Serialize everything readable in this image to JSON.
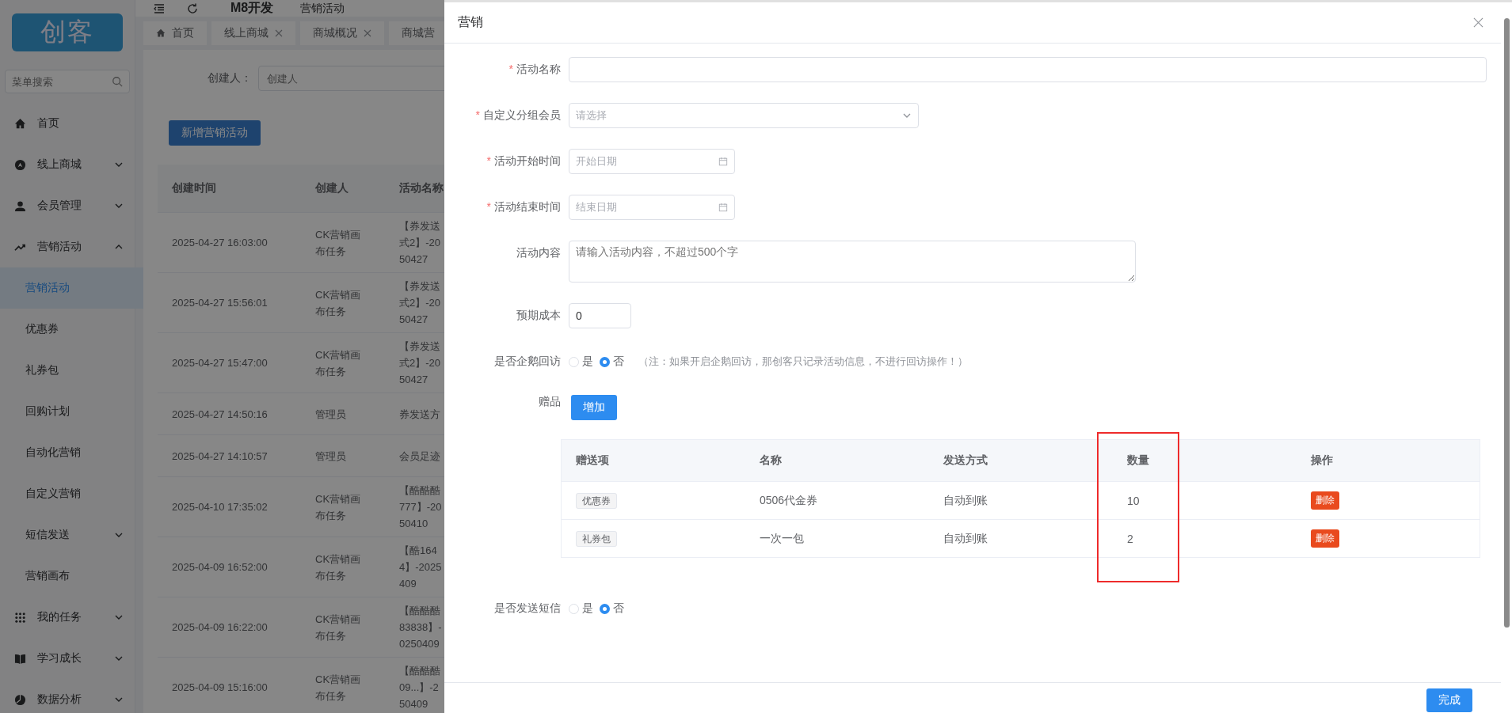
{
  "sidebar": {
    "logo": "创客",
    "search": {
      "placeholder": "菜单搜索"
    },
    "items": [
      {
        "label": "首页",
        "kind": "link"
      },
      {
        "label": "线上商城",
        "kind": "group",
        "expanded": false
      },
      {
        "label": "会员管理",
        "kind": "group",
        "expanded": false
      },
      {
        "label": "营销活动",
        "kind": "group",
        "expanded": true,
        "children": [
          {
            "label": "营销活动",
            "kind": "link",
            "selected": true
          },
          {
            "label": "优惠券",
            "kind": "link",
            "selected": false
          },
          {
            "label": "礼券包",
            "kind": "link",
            "selected": false
          },
          {
            "label": "回购计划",
            "kind": "link",
            "selected": false
          },
          {
            "label": "自动化营销",
            "kind": "link",
            "selected": false
          },
          {
            "label": "自定义营销",
            "kind": "link",
            "selected": false
          },
          {
            "label": "短信发送",
            "kind": "group",
            "selected": false
          },
          {
            "label": "营销画布",
            "kind": "link",
            "selected": false
          }
        ]
      },
      {
        "label": "我的任务",
        "kind": "group",
        "expanded": false
      },
      {
        "label": "学习成长",
        "kind": "group",
        "expanded": false
      },
      {
        "label": "数据分析",
        "kind": "group",
        "expanded": false
      }
    ]
  },
  "header": {
    "app": "M8开发",
    "page": "营销活动"
  },
  "tabs": [
    {
      "label": "首页",
      "closable": false
    },
    {
      "label": "线上商城",
      "closable": true
    },
    {
      "label": "商城概况",
      "closable": true
    },
    {
      "label": "商城营",
      "closable": false
    }
  ],
  "filter": {
    "label": "创建人：",
    "placeholder": "创建人"
  },
  "add_button": "新增营销活动",
  "table": {
    "columns": [
      "创建时间",
      "创建人",
      "活动名称"
    ],
    "rows": [
      {
        "time": "2025-04-27 16:03:00",
        "creator": "CK营销画布任务",
        "name": [
          "【券发送",
          "式2】-20",
          "50427"
        ]
      },
      {
        "time": "2025-04-27 15:56:01",
        "creator": "CK营销画布任务",
        "name": [
          "【券发送",
          "式2】-20",
          "50427"
        ]
      },
      {
        "time": "2025-04-27 15:47:00",
        "creator": "CK营销画布任务",
        "name": [
          "【券发送",
          "式2】-20",
          "50427"
        ]
      },
      {
        "time": "2025-04-27 14:50:16",
        "creator": "管理员",
        "name": [
          "券发送方"
        ]
      },
      {
        "time": "2025-04-27 14:10:57",
        "creator": "管理员",
        "name": [
          "会员足迹"
        ]
      },
      {
        "time": "2025-04-10 17:35:02",
        "creator": "CK营销画布任务",
        "name": [
          "【酷酷酷",
          "777】-20",
          "50410"
        ]
      },
      {
        "time": "2025-04-09 16:52:00",
        "creator": "CK营销画布任务",
        "name": [
          "【酷164",
          "4】-2025",
          "409"
        ]
      },
      {
        "time": "2025-04-09 16:22:00",
        "creator": "CK营销画布任务",
        "name": [
          "【酷酷酷",
          "83838】-",
          "0250409"
        ]
      },
      {
        "time": "2025-04-09 15:16:00",
        "creator": "CK营销画布任务",
        "name": [
          "【酷酷酷",
          "09...】-2",
          "50409"
        ]
      }
    ]
  },
  "drawer": {
    "title": "营销",
    "fields": [
      {
        "kind": "text",
        "label": "活动名称",
        "required_mark": "*"
      },
      {
        "kind": "select",
        "label": "自定义分组会员",
        "required_mark": "*",
        "placeholder": "请选择"
      },
      {
        "kind": "date",
        "label": "活动开始时间",
        "required_mark": "*",
        "placeholder": "开始日期"
      },
      {
        "kind": "date",
        "label": "活动结束时间",
        "required_mark": "*",
        "placeholder": "结束日期"
      },
      {
        "kind": "textarea",
        "label": "活动内容",
        "placeholder": "请输入活动内容，不超过500个字"
      },
      {
        "kind": "number",
        "label": "预期成本",
        "value": "0"
      },
      {
        "kind": "radio",
        "label": "是否企鹅回访",
        "options": [
          {
            "label": "是",
            "selected": false
          },
          {
            "label": "否",
            "selected": true
          }
        ],
        "note": "（注：如果开启企鹅回访，那创客只记录活动信息，不进行回访操作！）"
      },
      {
        "kind": "gifts",
        "label": "赠品",
        "add_button": "增加",
        "columns": [
          "赠送项",
          "名称",
          "发送方式",
          "数量",
          "操作"
        ],
        "rows": [
          {
            "type": "优惠券",
            "name": "0506代金券",
            "method": "自动到账",
            "quantity": "10",
            "action": "删除"
          },
          {
            "type": "礼券包",
            "name": "一次一包",
            "method": "自动到账",
            "quantity": "2",
            "action": "删除"
          }
        ]
      },
      {
        "kind": "radio",
        "label": "是否发送短信",
        "options": [
          {
            "label": "是",
            "selected": false
          },
          {
            "label": "否",
            "selected": true
          }
        ]
      }
    ],
    "submit": "完成"
  }
}
